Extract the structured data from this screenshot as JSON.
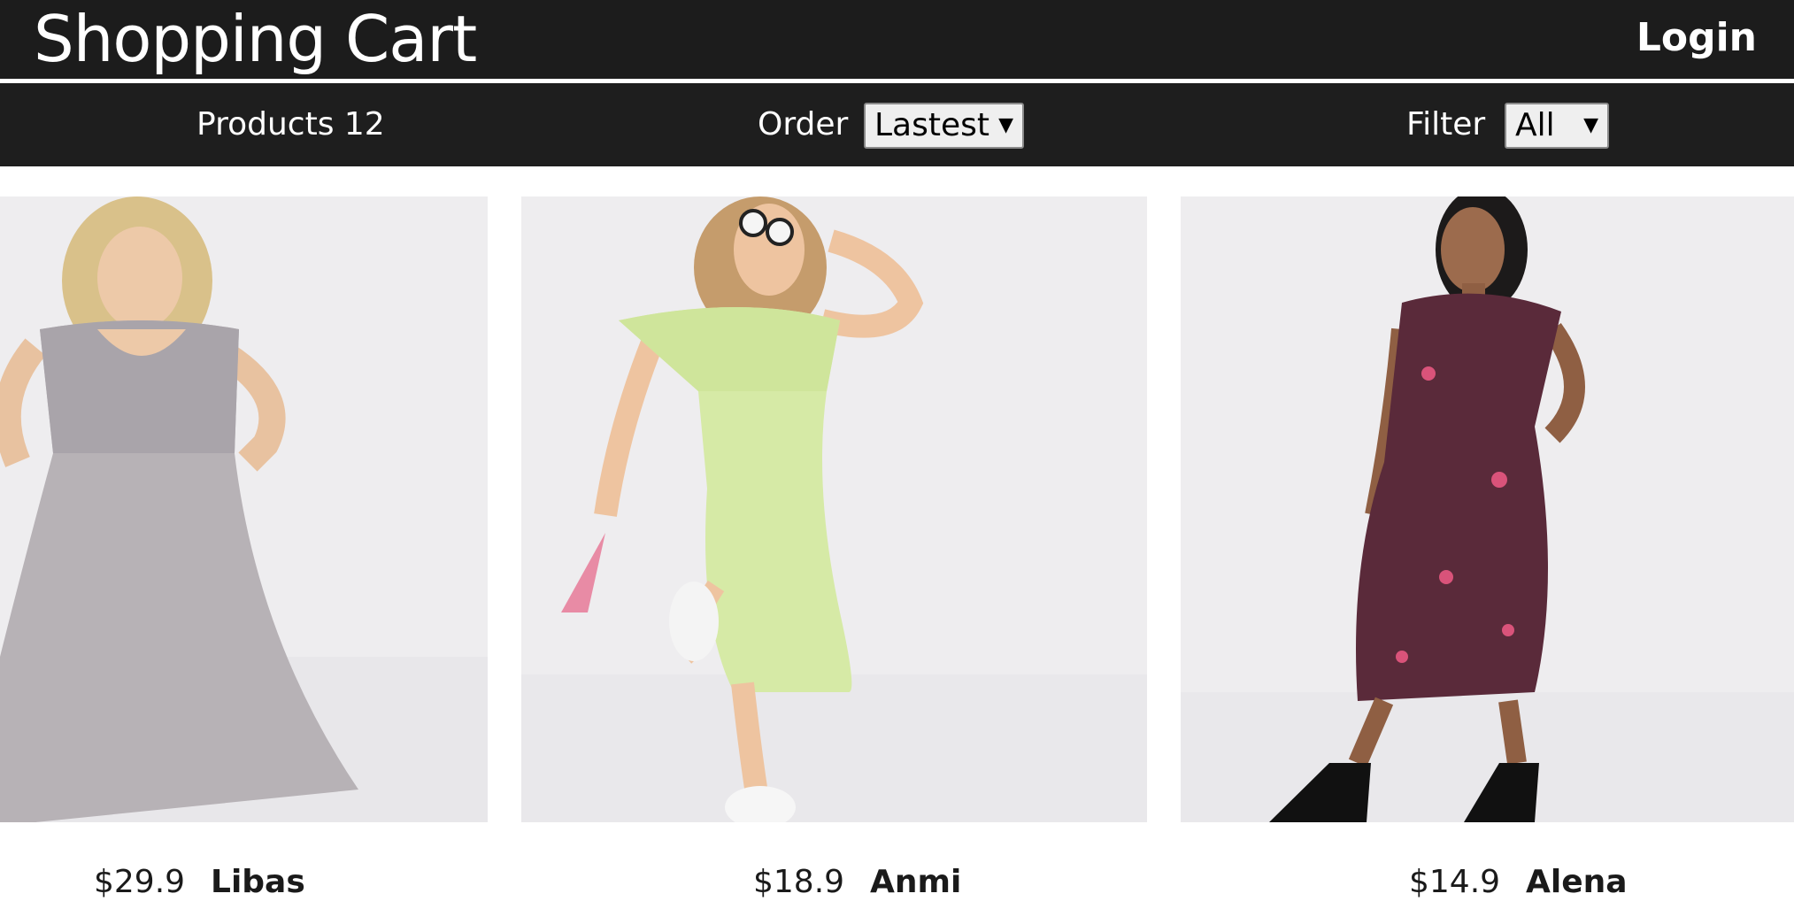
{
  "header": {
    "brand": "Shopping Cart",
    "login_label": "Login"
  },
  "filter_bar": {
    "products_count": "Products 12",
    "order_label": "Order",
    "order_selected": "Lastest",
    "filter_label": "Filter",
    "filter_selected": "All"
  },
  "products": [
    {
      "price": "$29.9",
      "name": "Libas"
    },
    {
      "price": "$18.9",
      "name": "Anmi"
    },
    {
      "price": "$14.9",
      "name": "Alena"
    }
  ],
  "icons": {
    "dropdown_caret": "▼"
  },
  "colors": {
    "header_bg": "#1c1c1c",
    "filterbar_bg": "#1e1e1e",
    "image_bg": "#eeedef"
  }
}
